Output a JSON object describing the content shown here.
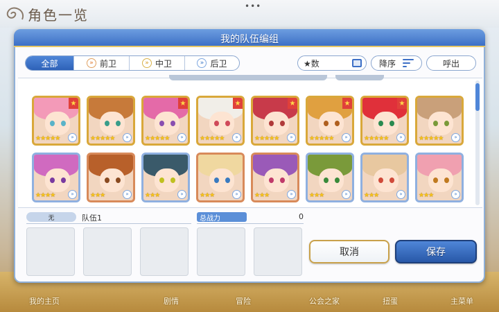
{
  "background": {
    "screen_title": "角色一览",
    "menu_dots": "•••",
    "bottom_nav": [
      "我的主页",
      "剧情",
      "冒险",
      "公会之家",
      "扭蛋",
      "主菜单"
    ]
  },
  "dialog": {
    "title": "我的队伍编组",
    "tabs": [
      {
        "label": "全部",
        "active": true
      },
      {
        "label": "前卫",
        "icon": "front-chevron-icon"
      },
      {
        "label": "中卫",
        "icon": "middle-chevron-icon"
      },
      {
        "label": "后卫",
        "icon": "back-chevron-icon"
      }
    ],
    "star_sort_label": "★数",
    "order_label": "降序",
    "call_label": "呼出"
  },
  "roster": [
    {
      "stars": "★★★★★",
      "frame": "gold",
      "rank_flag": true,
      "hair": "#f39ab8",
      "eyes": "#5ab3c8"
    },
    {
      "stars": "★★★★★",
      "frame": "gold",
      "rank_flag": false,
      "hair": "#c77a3a",
      "eyes": "#3a9d8a"
    },
    {
      "stars": "★★★★★",
      "frame": "gold",
      "rank_flag": true,
      "hair": "#e46aa8",
      "eyes": "#8a4fb0"
    },
    {
      "stars": "★★★★★",
      "frame": "gold",
      "rank_flag": true,
      "hair": "#f1eee8",
      "eyes": "#d04a5a"
    },
    {
      "stars": "★★★★★",
      "frame": "gold",
      "rank_flag": true,
      "hair": "#c83a4a",
      "eyes": "#b03a3a"
    },
    {
      "stars": "★★★★★",
      "frame": "gold",
      "rank_flag": true,
      "hair": "#e0a040",
      "eyes": "#b06020"
    },
    {
      "stars": "★★★★★",
      "frame": "gold",
      "rank_flag": true,
      "hair": "#e0303a",
      "eyes": "#2a8a50"
    },
    {
      "stars": "★★★★★",
      "frame": "gold",
      "rank_flag": false,
      "hair": "#c9a07a",
      "eyes": "#7a9a3a"
    },
    {
      "stars": "★★★★",
      "frame": "silver",
      "rank_flag": false,
      "hair": "#d06ac0",
      "eyes": "#7a3aa0"
    },
    {
      "stars": "★★★",
      "frame": "bronze",
      "rank_flag": false,
      "hair": "#b8602a",
      "eyes": "#8a4a20"
    },
    {
      "stars": "★★★",
      "frame": "silver",
      "rank_flag": false,
      "hair": "#3a5a6a",
      "eyes": "#c0c020"
    },
    {
      "stars": "★★★",
      "frame": "bronze",
      "rank_flag": false,
      "hair": "#f0d8a0",
      "eyes": "#3a7ac0"
    },
    {
      "stars": "★★★",
      "frame": "bronze",
      "rank_flag": false,
      "hair": "#9a5ab8",
      "eyes": "#c03a6a"
    },
    {
      "stars": "★★★",
      "frame": "silver",
      "rank_flag": false,
      "hair": "#7a9a3a",
      "eyes": "#3a8a3a"
    },
    {
      "stars": "★★★",
      "frame": "silver",
      "rank_flag": false,
      "hair": "#e8c8a0",
      "eyes": "#d04a3a"
    },
    {
      "stars": "★★★",
      "frame": "silver",
      "rank_flag": false,
      "hair": "#f0a0b0",
      "eyes": "#c07a20"
    }
  ],
  "team": {
    "tag": "无",
    "name": "队伍1",
    "power_label": "总战力",
    "power_value": "0"
  },
  "buttons": {
    "cancel": "取消",
    "save": "保存"
  }
}
